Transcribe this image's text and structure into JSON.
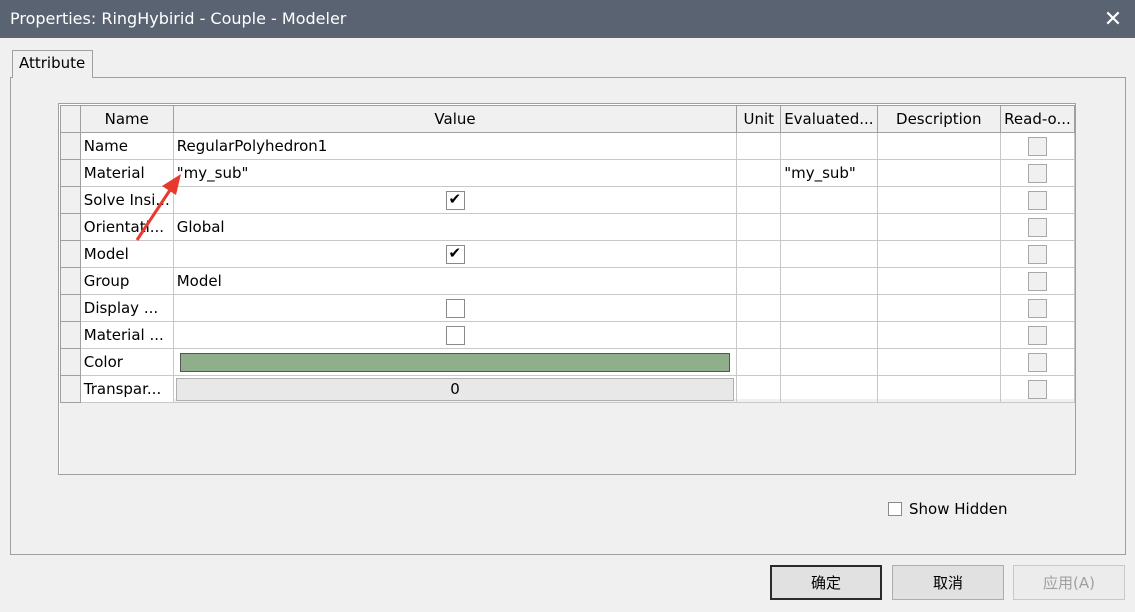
{
  "window": {
    "title": "Properties: RingHybirid - Couple - Modeler",
    "close_glyph": "✕"
  },
  "tabs": [
    {
      "label": "Attribute"
    }
  ],
  "grid": {
    "columns": [
      "Name",
      "Value",
      "Unit",
      "Evaluated...",
      "Description",
      "Read-o..."
    ],
    "rows": [
      {
        "name": "Name",
        "value": "RegularPolyhedron1",
        "unit": "",
        "evaluated": "",
        "description": "",
        "readonly": false
      },
      {
        "name": "Material",
        "value": "\"my_sub\"",
        "unit": "",
        "evaluated": "\"my_sub\"",
        "description": "",
        "readonly": false
      },
      {
        "name": "Solve Insi...",
        "value_checkbox": true,
        "unit": "",
        "evaluated": "",
        "description": "",
        "readonly": false
      },
      {
        "name": "Orientati...",
        "value": "Global",
        "unit": "",
        "evaluated": "",
        "description": "",
        "readonly": false
      },
      {
        "name": "Model",
        "value_checkbox": true,
        "unit": "",
        "evaluated": "",
        "description": "",
        "readonly": false
      },
      {
        "name": "Group",
        "value": "Model",
        "unit": "",
        "evaluated": "",
        "description": "",
        "readonly": false
      },
      {
        "name": "Display ...",
        "value_checkbox": false,
        "unit": "",
        "evaluated": "",
        "description": "",
        "readonly": false
      },
      {
        "name": "Material ...",
        "value_checkbox": false,
        "unit": "",
        "evaluated": "",
        "description": "",
        "readonly": false
      },
      {
        "name": "Color",
        "value_color": "#8fae8c",
        "unit": "",
        "evaluated": "",
        "description": "",
        "readonly": false
      },
      {
        "name": "Transpar...",
        "value_spin": "0",
        "unit": "",
        "evaluated": "",
        "description": "",
        "readonly": false
      }
    ]
  },
  "show_hidden": {
    "label": "Show Hidden",
    "checked": false
  },
  "buttons": {
    "ok": "确定",
    "cancel": "取消",
    "apply": "应用(A)"
  },
  "colors": {
    "titlebar": "#5a6372",
    "annotation_arrow": "#e8392f",
    "color_swatch": "#8fae8c"
  },
  "icons": {
    "close": "close-icon",
    "annotation": "red-arrow-annotation"
  }
}
